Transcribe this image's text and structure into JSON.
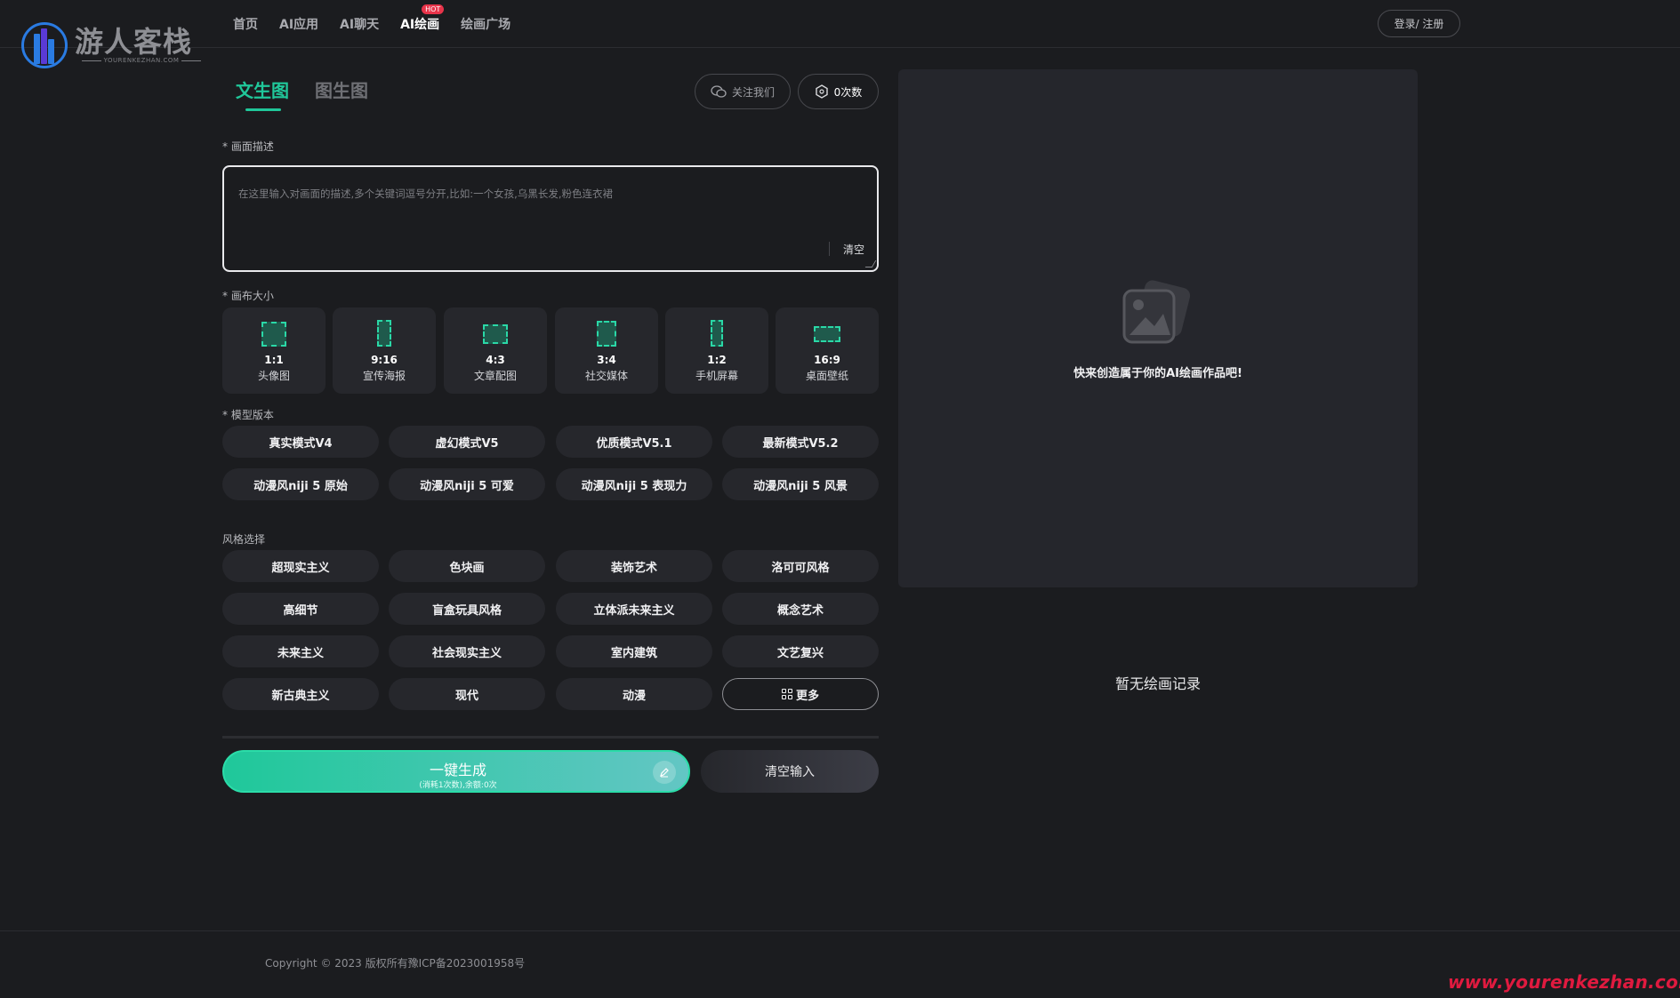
{
  "brand": {
    "logo_text": "游人客栈",
    "logo_sub": "YOURENKEZHAN.COM"
  },
  "nav": {
    "items": [
      "首页",
      "AI应用",
      "AI聊天",
      "AI绘画",
      "绘画广场"
    ],
    "active": "AI绘画",
    "hot_badge": "HOT",
    "login": "登录/ 注册"
  },
  "mode_tabs": {
    "text_to_image": "文生图",
    "image_to_image": "图生图"
  },
  "follow_button": "关注我们",
  "credits_button": "0次数",
  "prompt": {
    "label": "* 画面描述",
    "placeholder": "在这里输入对画面的描述,多个关键词逗号分开,比如:一个女孩,乌黑长发,粉色连衣裙",
    "clear": "清空"
  },
  "canvas_size": {
    "label": "* 画布大小",
    "options": [
      {
        "ratio": "1:1",
        "name": "头像图"
      },
      {
        "ratio": "9:16",
        "name": "宣传海报"
      },
      {
        "ratio": "4:3",
        "name": "文章配图"
      },
      {
        "ratio": "3:4",
        "name": "社交媒体"
      },
      {
        "ratio": "1:2",
        "name": "手机屏幕"
      },
      {
        "ratio": "16:9",
        "name": "桌面壁纸"
      }
    ]
  },
  "model_version": {
    "label": "* 模型版本",
    "options": [
      "真实模式V4",
      "虚幻模式V5",
      "优质模式V5.1",
      "最新模式V5.2",
      "动漫风niji 5 原始",
      "动漫风niji 5 可爱",
      "动漫风niji 5 表现力",
      "动漫风niji 5 风景"
    ]
  },
  "style": {
    "label": "风格选择",
    "options": [
      "超现实主义",
      "色块画",
      "装饰艺术",
      "洛可可风格",
      "高细节",
      "盲盒玩具风格",
      "立体派未来主义",
      "概念艺术",
      "未来主义",
      "社会现实主义",
      "室内建筑",
      "文艺复兴",
      "新古典主义",
      "现代",
      "动漫"
    ],
    "more": "更多"
  },
  "actions": {
    "generate": "一键生成",
    "generate_sub": "(消耗1次数),余额:0次",
    "clear_input": "清空输入"
  },
  "canvas": {
    "empty_text": "快来创造属于你的AI绘画作品吧!"
  },
  "history": {
    "empty_text": "暂无绘画记录"
  },
  "footer": {
    "copyright": "Copyright © 2023 版权所有豫ICP备2023001958号"
  },
  "watermark": "www.yourenkezhan.com",
  "colors": {
    "accent": "#20c79a",
    "background": "#1b1c1f",
    "card": "#26272c",
    "hot": "#e8344a",
    "watermark": "#e01a3f"
  }
}
